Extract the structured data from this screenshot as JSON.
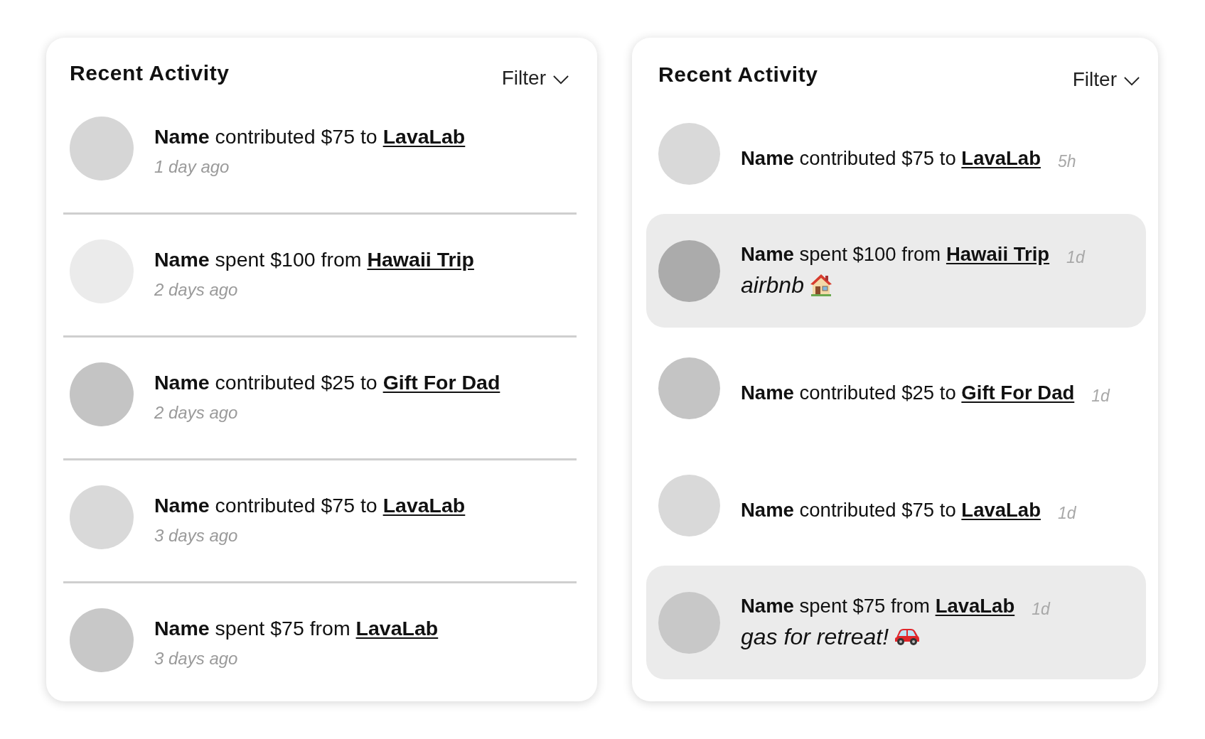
{
  "panels": [
    {
      "kind": "stacked",
      "title": "Recent Activity",
      "filter": "Filter",
      "items": [
        {
          "text": "**Name** contributed $75 to",
          "link": "LavaLab",
          "time": "1 day ago",
          "color": "#d6d6d6"
        },
        {
          "text": "**Name** spent $100 from",
          "link": "Hawaii Trip",
          "time": "2 days ago",
          "color": "#ebebeb"
        },
        {
          "text": "**Name** contributed $25 to",
          "link": "Gift For Dad",
          "time": "2 days ago",
          "color": "#c4c4c4"
        },
        {
          "text": "**Name** contributed $75 to",
          "link": "LavaLab",
          "time": "3 days ago",
          "color": "#d9d9d9"
        },
        {
          "text": "**Name** spent $75 from",
          "link": "LavaLab",
          "time": "3 days ago",
          "color": "#c8c8c8"
        }
      ]
    },
    {
      "kind": "inline",
      "title": "Recent Activity",
      "filter": "Filter",
      "items": [
        {
          "text": "**Name** contributed $75 to",
          "link": "LavaLab",
          "time": "5h",
          "color": "#d9d9d9",
          "highlighted": false
        },
        {
          "text": "**Name** spent $100 from",
          "link": "Hawaii Trip",
          "time": "1d",
          "color": "#ababab",
          "highlighted": true,
          "note": "airbnb"
        },
        {
          "text": "**Name** contributed $25 to",
          "link": "Gift For Dad",
          "time": "1d",
          "color": "#c4c4c4",
          "highlighted": false
        },
        {
          "text": "**Name** contributed $75 to",
          "link": "LavaLab",
          "time": "1d",
          "color": "#d9d9d9",
          "highlighted": false
        },
        {
          "text": "**Name** spent $75 from",
          "link": "LavaLab",
          "time": "1d",
          "color": "#c8c8c8",
          "highlighted": true,
          "note": "gas for retreat!"
        }
      ]
    }
  ]
}
